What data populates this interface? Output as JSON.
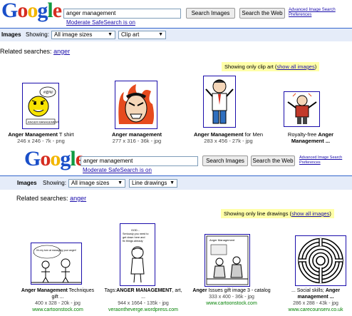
{
  "top": {
    "logo": "Google",
    "query": "anger management",
    "search_images": "Search Images",
    "search_web": "Search the Web",
    "adv_search": "Advanced Image Search",
    "preferences": "Preferences",
    "safesearch": "Moderate SafeSearch is on",
    "images_label": "Images",
    "showing": "Showing:",
    "size_select": "All image sizes",
    "type_select": "Clip art",
    "related_label": "Related searches:",
    "related_link": "anger",
    "note_text": "Showing only clip art (",
    "note_link": "show all images",
    "note_close": ")",
    "results": [
      {
        "bold": "Anger Management",
        "rest": " T shirt",
        "meta": "246 x 246 - 7k - png"
      },
      {
        "bold": "Anger management",
        "rest": "",
        "meta": "277 x 316 - 36k - jpg"
      },
      {
        "bold": "Anger Management",
        "rest": " for Men",
        "meta": "283 x 456 - 27k - jpg"
      },
      {
        "bold": "",
        "rest": "Royalty-free ",
        "bold2": "Anger Management ...",
        "meta": ""
      }
    ]
  },
  "bottom": {
    "logo": "Google",
    "query": "anger management",
    "search_images": "Search Images",
    "search_web": "Search the Web",
    "adv_search": "Advanced Image Search",
    "preferences": "Preferences",
    "safesearch": "Moderate SafeSearch is on",
    "images_label": "Images",
    "showing": "Showing:",
    "size_select": "All image sizes",
    "type_select": "Line drawings",
    "related_label": "Related searches:",
    "related_link": "anger",
    "note_text": "Showing only line drawings (",
    "note_link": "show all images",
    "note_close": ")",
    "results": [
      {
        "line1_bold": "Anger Management",
        "line1_rest": " Techniques",
        "line2": "gift ...",
        "meta": "400 x 328 - 20k - jpg",
        "url": "www.cartoonstock.com"
      },
      {
        "line1_rest": "Tags:",
        "line1_bold": "ANGER MANAGEMENT",
        "line1_tail": ", art,",
        "line2": "...",
        "meta": "944 x 1664 - 135k - jpg",
        "url": "veraontheverge.wordpress.com"
      },
      {
        "line1_bold": "Anger",
        "line1_rest": " Issues gift image 3 - catalog",
        "line2": "",
        "meta": "333 x 400 - 36k - jpg",
        "url": "www.cartoonstock.com"
      },
      {
        "line1_rest": "... Social skills; ",
        "line1_bold": "Anger",
        "line2": "management ...",
        "meta": "286 x 288 - 43k - jpg",
        "url": "www.carecounserv.co.uk"
      }
    ],
    "cartoon_text_1": "It's my turn at managing your anger!",
    "cartoon_text_2": "GOD... Seriously you need to get down here and fix things already. Love, Bleep",
    "cartoon_text_3": "Anger Management"
  },
  "colors": {
    "bar_bg": "#e5ecf9",
    "note_bg": "#ffffa8",
    "link": "#1a0dab",
    "url_green": "#008000"
  }
}
